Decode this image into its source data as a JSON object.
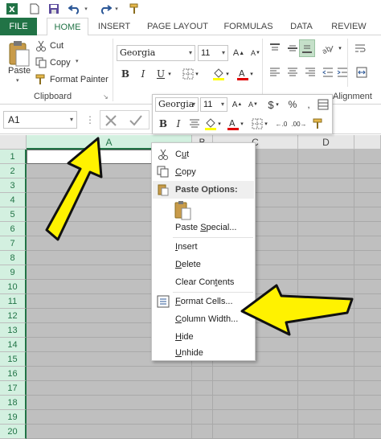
{
  "tabs": {
    "file": "FILE",
    "home": "HOME",
    "insert": "INSERT",
    "page_layout": "PAGE LAYOUT",
    "formulas": "FORMULAS",
    "data": "DATA",
    "review": "REVIEW"
  },
  "ribbon": {
    "paste": "Paste",
    "cut": "Cut",
    "copy": "Copy",
    "format_painter": "Format Painter",
    "clipboard_label": "Clipboard",
    "font_name": "Georgia",
    "font_size": "11",
    "alignment_label": "Alignment",
    "bold": "B",
    "italic": "I",
    "underline": "U"
  },
  "formula_bar": {
    "name_box": "A1"
  },
  "mini_toolbar": {
    "font_name": "Georgia",
    "font_size": "11",
    "currency": "$",
    "percent": "%",
    "bold": "B",
    "italic": "I"
  },
  "grid": {
    "columns": [
      "A",
      "B",
      "C",
      "D"
    ],
    "rows": [
      "1",
      "2",
      "3",
      "4",
      "5",
      "6",
      "7",
      "8",
      "9",
      "10",
      "11",
      "12",
      "13",
      "14",
      "15",
      "16",
      "17",
      "18",
      "19",
      "20"
    ]
  },
  "context_menu": {
    "cut": "Cut",
    "copy": "Copy",
    "paste_options": "Paste Options:",
    "paste_special": "Paste Special...",
    "insert": "Insert",
    "delete": "Delete",
    "clear_contents": "Clear Contents",
    "format_cells": "Format Cells...",
    "column_width": "Column Width...",
    "hide": "Hide",
    "unhide": "Unhide"
  },
  "colors": {
    "accent": "#217346",
    "arrow_fill": "#fff200",
    "selection_header": "#d3f0e0",
    "grid_fill": "#bfbfbf"
  }
}
